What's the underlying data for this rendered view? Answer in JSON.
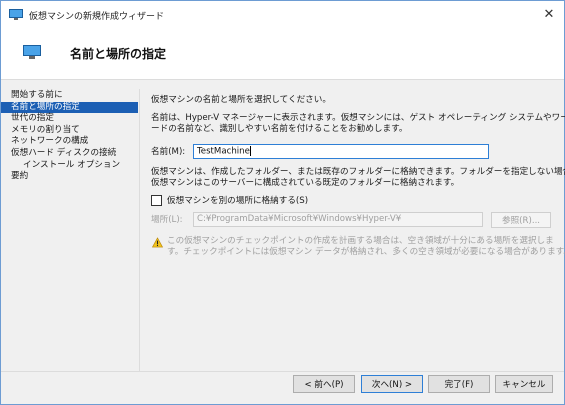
{
  "window": {
    "title": "仮想マシンの新規作成ウィザード",
    "close_glyph": "✕"
  },
  "header": {
    "title": "名前と場所の指定"
  },
  "nav": {
    "items": [
      {
        "label": "開始する前に",
        "selected": false,
        "sub": false
      },
      {
        "label": "名前と場所の指定",
        "selected": true,
        "sub": false
      },
      {
        "label": "世代の指定",
        "selected": false,
        "sub": false
      },
      {
        "label": "メモリの割り当て",
        "selected": false,
        "sub": false
      },
      {
        "label": "ネットワークの構成",
        "selected": false,
        "sub": false
      },
      {
        "label": "仮想ハード ディスクの接続",
        "selected": false,
        "sub": false
      },
      {
        "label": "インストール オプション",
        "selected": false,
        "sub": true
      },
      {
        "label": "要約",
        "selected": false,
        "sub": false
      }
    ]
  },
  "content": {
    "intro": "仮想マシンの名前と場所を選択してください。",
    "desc_line1": "名前は、Hyper-V マネージャーに表示されます。仮想マシンには、ゲスト オペレーティング システムやワークロ",
    "desc_line2": "ードの名前など、識別しやすい名前を付けることをお勧めします。",
    "name_label": "名前(M):",
    "name_value": "TestMachine",
    "store_line1": "仮想マシンは、作成したフォルダー、または既存のフォルダーに格納できます。フォルダーを指定しない場合、",
    "store_line2": "仮想マシンはこのサーバーに構成されている既定のフォルダーに格納されます。",
    "checkbox_label": "仮想マシンを別の場所に格納する(S)",
    "checkbox_checked": false,
    "location_label": "場所(L):",
    "location_value": "C:¥ProgramData¥Microsoft¥Windows¥Hyper-V¥",
    "browse_label": "参照(R)...",
    "warn_line1": "この仮想マシンのチェックポイントの作成を計画する場合は、空き領域が十分にある場所を選択しま",
    "warn_line2": "す。チェックポイントには仮想マシン データが格納され、多くの空き領域が必要になる場合があります。"
  },
  "footer": {
    "prev_label": "< 前へ(P)",
    "next_label": "次へ(N) >",
    "finish_label": "完了(F)",
    "cancel_label": "キャンセル"
  },
  "colors": {
    "accent": "#1c5fb4",
    "warning": "#f2c31b"
  },
  "icons": {
    "app": "vm-monitor-icon",
    "warning": "warning-triangle-icon"
  }
}
